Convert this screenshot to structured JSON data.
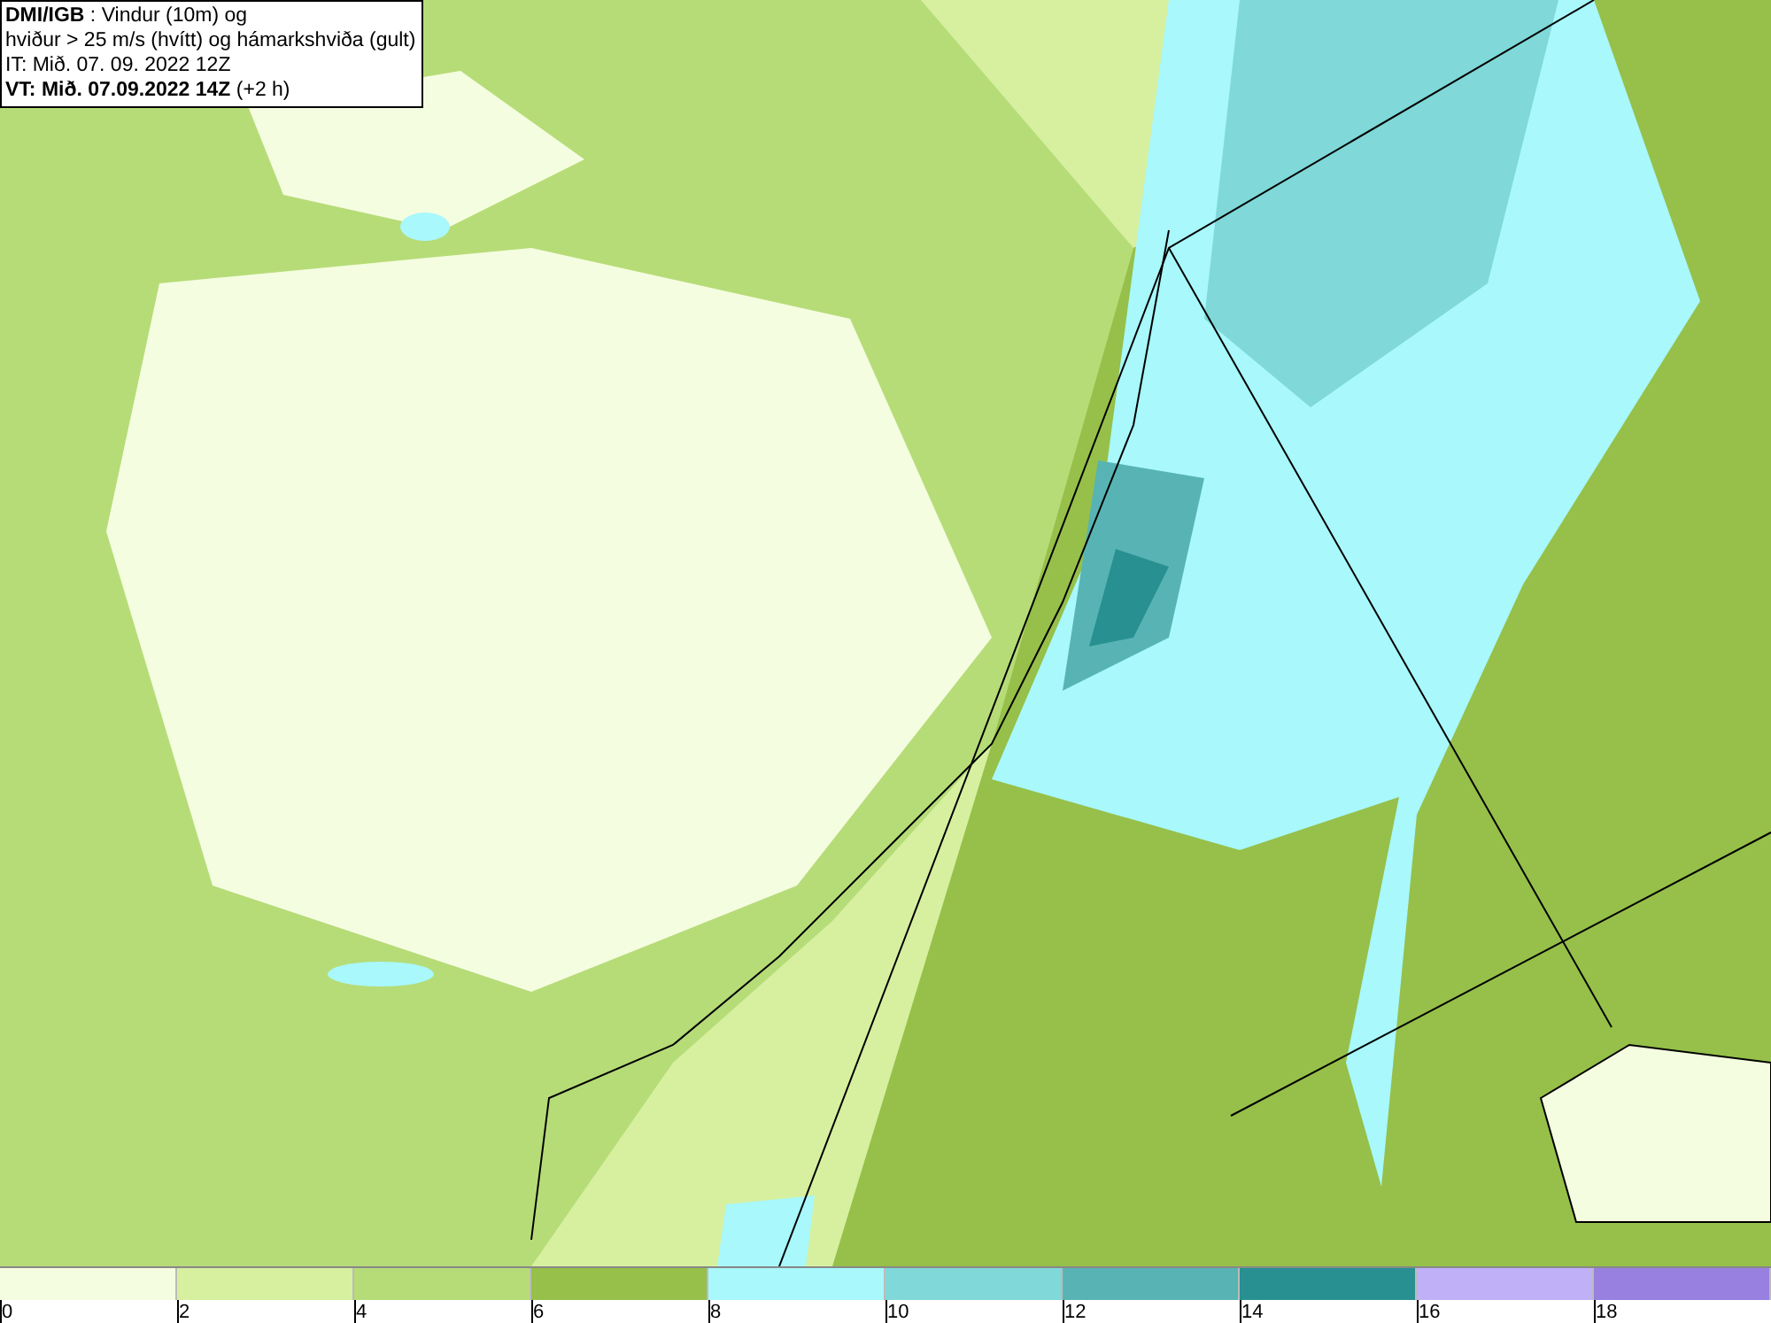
{
  "title_box": {
    "lines": [
      "**DMI/IGB** : Vindur (10m) og",
      "hviður > 25 m/s (hvítt) og hámarkshviða (gult)",
      "IT: Mið. 07. 09. 2022 12Z",
      "**VT: Mið. 07.09.2022 14Z** (+2 h)"
    ]
  },
  "legend": {
    "bins": [
      {
        "color": "#f5fde0",
        "label": "0"
      },
      {
        "color": "#d6f0a0",
        "label": "2"
      },
      {
        "color": "#b6dc78",
        "label": "4"
      },
      {
        "color": "#96c04a",
        "label": "6"
      },
      {
        "color": "#a8f8fc",
        "label": "8"
      },
      {
        "color": "#80d8d8",
        "label": "10"
      },
      {
        "color": "#58b4b4",
        "label": "12"
      },
      {
        "color": "#289090",
        "label": "14"
      },
      {
        "color": "#c0b0f8",
        "label": "16"
      },
      {
        "color": "#9880e0",
        "label": "18"
      }
    ]
  }
}
